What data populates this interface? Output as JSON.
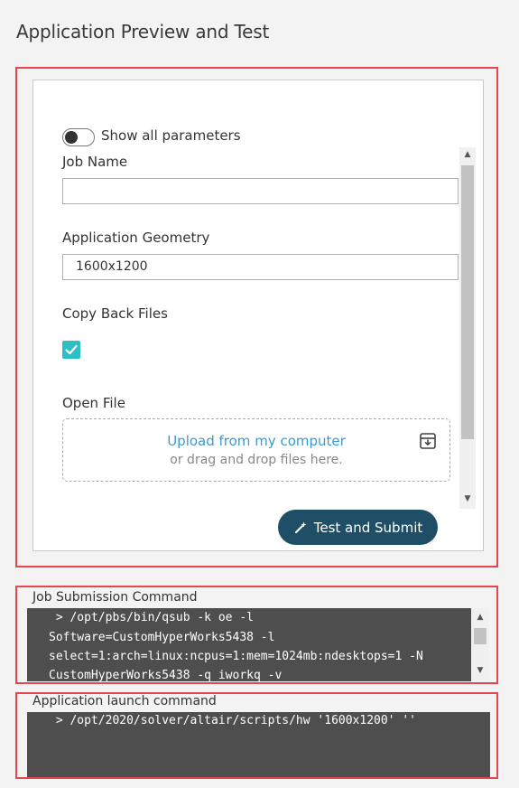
{
  "page": {
    "title": "Application Preview and Test"
  },
  "form": {
    "toggle_label": "Show all parameters",
    "toggle_state": "off",
    "job_name_label": "Job Name",
    "job_name_value": "",
    "geometry_label": "Application Geometry",
    "geometry_value": "1600x1200",
    "copy_back_label": "Copy Back Files",
    "copy_back_checked": true,
    "open_file_label": "Open File",
    "upload_link": "Upload from my computer",
    "drag_text": "or drag and drop files here.",
    "submit_label": "Test and Submit"
  },
  "job_submission": {
    "label": "Job Submission Command",
    "lines": [
      " > /opt/pbs/bin/qsub -k oe -l",
      "Software=CustomHyperWorks5438 -l",
      "select=1:arch=linux:ncpus=1:mem=1024mb:ndesktops=1 -N",
      "CustomHyperWorks5438 -q iworkq -v"
    ]
  },
  "launch": {
    "label": "Application launch command",
    "lines": [
      " > /opt/2020/solver/altair/scripts/hw '1600x1200' ''"
    ]
  },
  "icons": {
    "toggle": "toggle-switch-icon",
    "check": "checkmark-icon",
    "archive": "archive-box-icon",
    "wand": "magic-wand-icon",
    "scroll_up": "chevron-up-icon",
    "scroll_down": "chevron-down-icon"
  },
  "colors": {
    "accent": "#2cbfc4",
    "button": "#1f4f66",
    "link": "#3b9ad1",
    "highlight_border": "#e5474f",
    "console_bg": "#4e4e4e"
  }
}
